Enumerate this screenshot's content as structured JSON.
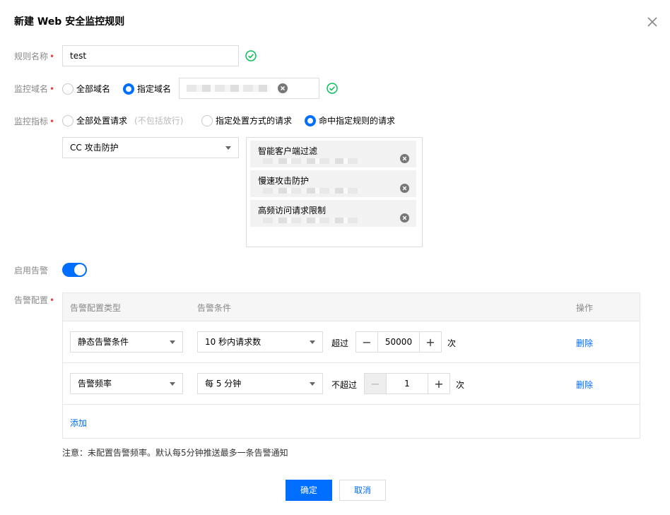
{
  "dialog": {
    "title": "新建 Web 安全监控规则",
    "close_icon": "close-icon"
  },
  "form": {
    "rule_name": {
      "label": "规则名称",
      "value": "test"
    },
    "domain": {
      "label": "监控域名",
      "options": [
        "全部域名",
        "指定域名"
      ],
      "selected": "指定域名"
    },
    "metric": {
      "label": "监控指标",
      "option_all": "全部处置请求",
      "option_all_hint": "(不包括放行)",
      "option_method": "指定处置方式的请求",
      "option_rules": "命中指定规则的请求",
      "selected": "命中指定规则的请求",
      "rule_type_select": "CC 攻击防护",
      "selected_rules": [
        "智能客户端过滤",
        "慢速攻击防护",
        "高频访问请求限制"
      ]
    },
    "alert_enable": {
      "label": "启用告警",
      "on": true
    },
    "alert_config": {
      "label": "告警配置",
      "headers": [
        "告警配置类型",
        "告警条件",
        "操作"
      ],
      "rows": [
        {
          "type": "静态告警条件",
          "condition": "10 秒内请求数",
          "operator": "超过",
          "value": "50000",
          "unit": "次",
          "action": "删除"
        },
        {
          "type": "告警频率",
          "condition": "每 5 分钟",
          "operator": "不超过",
          "value": "1",
          "unit": "次",
          "action": "删除"
        }
      ],
      "add_label": "添加"
    },
    "note": "注意：未配置告警频率。默认每5分钟推送最多一条告警通知"
  },
  "footer": {
    "confirm": "确定",
    "cancel": "取消"
  },
  "colors": {
    "primary": "#006eff",
    "success": "#0abf5b",
    "required": "#e54545"
  }
}
